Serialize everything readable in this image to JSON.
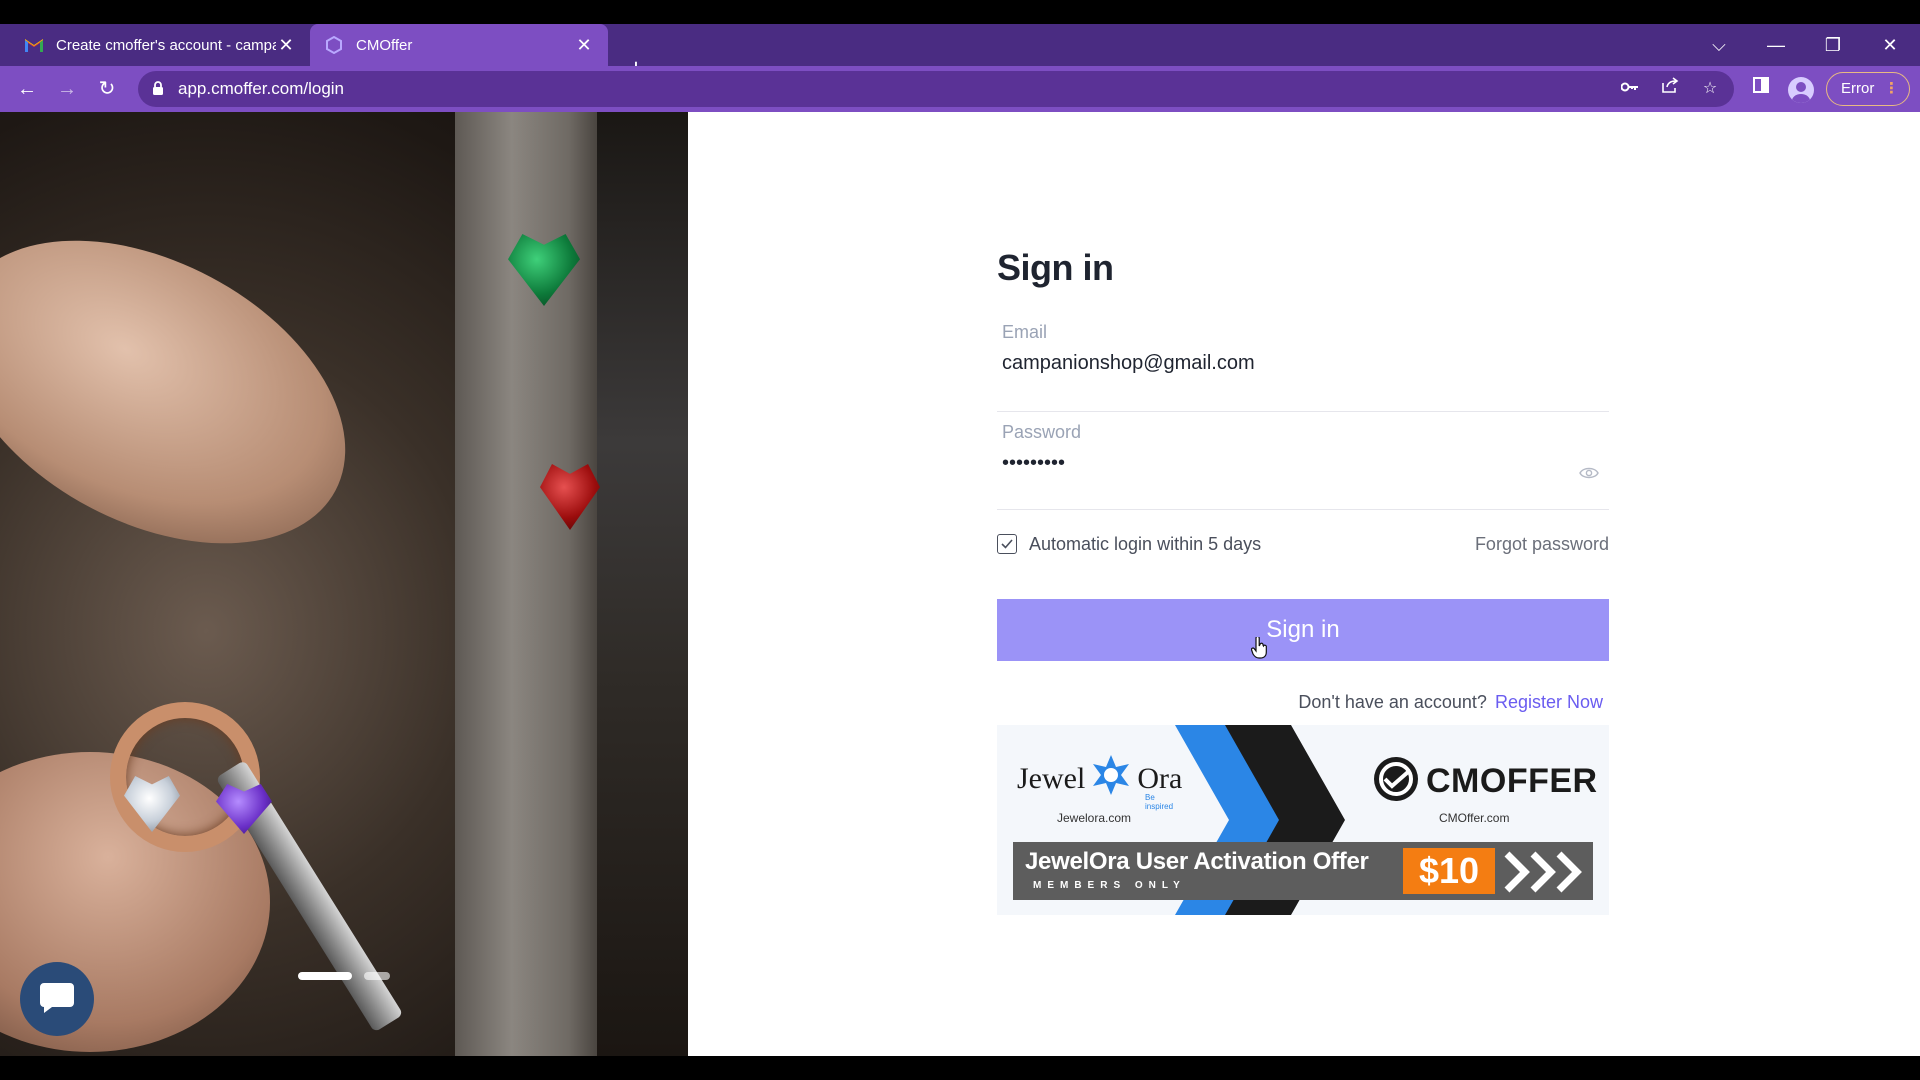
{
  "browser": {
    "tabs": [
      {
        "title": "Create cmoffer's account - campanionshop@gmail.com",
        "favicon": "gmail-icon",
        "active": false
      },
      {
        "title": "CMOffer",
        "favicon": "cmoffer-icon",
        "active": true
      }
    ],
    "new_tab_label": "+",
    "url": "app.cmoffer.com/login",
    "profile_status": "Error",
    "colors": {
      "tabstrip": "#4a2c82",
      "toolbar": "#7d4ec2"
    }
  },
  "hero": {
    "slide_count": 2,
    "active_slide": 1
  },
  "signin": {
    "title": "Sign in",
    "email_label": "Email",
    "email_value": "campanionshop@gmail.com",
    "password_label": "Password",
    "password_value": "•••••••••",
    "remember_label": "Automatic login within 5 days",
    "remember_checked": true,
    "forgot_label": "Forgot password",
    "button_label": "Sign in",
    "no_account_text": "Don't have an account?",
    "register_label": "Register Now",
    "colors": {
      "button": "#9b93f7",
      "link": "#6a5cf0"
    }
  },
  "banner": {
    "jewelora_name_left": "Jewel",
    "jewelora_name_right": "Ora",
    "jewelora_tagline": "Be inspired",
    "jewelora_site": "Jewelora.com",
    "cmoffer_name": "CMOFFER",
    "cmoffer_site": "CMOffer.com",
    "offer_title": "JewelOra User Activation Offer",
    "offer_subtitle": "MEMBERS ONLY",
    "offer_price": "$10",
    "colors": {
      "price": "#f47d12",
      "chevron_blue": "#2b86e6"
    }
  }
}
